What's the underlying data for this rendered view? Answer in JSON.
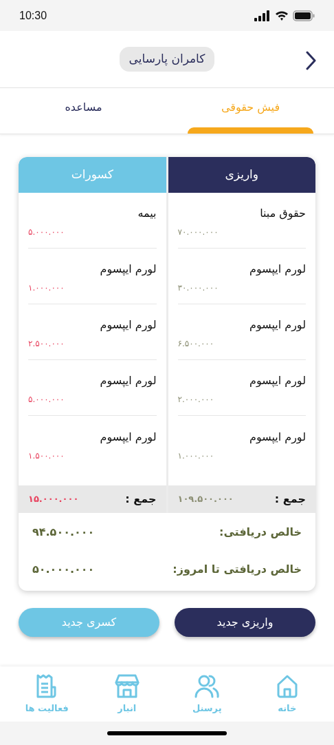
{
  "status_bar": {
    "time": "10:30"
  },
  "header": {
    "title": "کامران پارسایی"
  },
  "tabs": [
    {
      "label": "فیش حقوقی",
      "selected": true
    },
    {
      "label": "مساعده",
      "selected": false
    }
  ],
  "columns": [
    {
      "kind": "deposit",
      "title": "واریزی",
      "items": [
        {
          "label": "حقوق مبنا",
          "amount": "۷۰.۰۰۰.۰۰۰"
        },
        {
          "label": "لورم ایپسوم",
          "amount": "۳۰.۰۰۰.۰۰۰"
        },
        {
          "label": "لورم ایپسوم",
          "amount": "۶.۵۰۰.۰۰۰"
        },
        {
          "label": "لورم ایپسوم",
          "amount": "۲.۰۰۰.۰۰۰"
        },
        {
          "label": "لورم ایپسوم",
          "amount": "۱.۰۰۰.۰۰۰"
        }
      ],
      "total_label": "جمع :",
      "total": "۱۰۹.۵۰۰.۰۰۰"
    },
    {
      "kind": "deduction",
      "title": "کسورات",
      "items": [
        {
          "label": "بیمه",
          "amount": "۵.۰۰۰.۰۰۰"
        },
        {
          "label": "لورم ایپسوم",
          "amount": "۱.۰۰۰.۰۰۰"
        },
        {
          "label": "لورم ایپسوم",
          "amount": "۲.۵۰۰.۰۰۰"
        },
        {
          "label": "لورم ایپسوم",
          "amount": "۵.۰۰۰.۰۰۰"
        },
        {
          "label": "لورم ایپسوم",
          "amount": "۱.۵۰۰.۰۰۰"
        }
      ],
      "total_label": "جمع :",
      "total": "۱۵.۰۰۰.۰۰۰"
    }
  ],
  "summary": [
    {
      "label": "خالص دریافتی:",
      "value": "۹۴.۵۰۰.۰۰۰"
    },
    {
      "label": "خالص دریافتی تا امروز:",
      "value": "۵۰.۰۰۰.۰۰۰"
    }
  ],
  "buttons": [
    {
      "kind": "deposit",
      "label": "واریزی جدید"
    },
    {
      "kind": "deduction",
      "label": "کسری جدید"
    }
  ],
  "nav": [
    {
      "label": "خانه"
    },
    {
      "label": "پرسنل"
    },
    {
      "label": "انبار"
    },
    {
      "label": "فعالیت ها"
    }
  ]
}
